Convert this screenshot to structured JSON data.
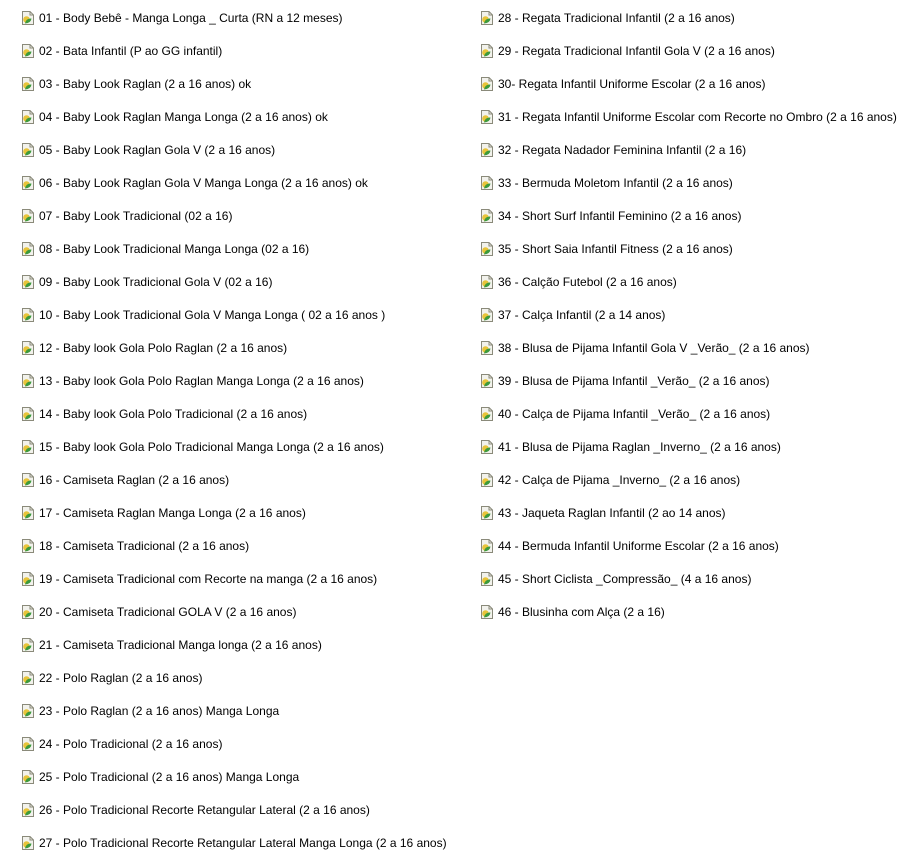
{
  "colors": {
    "icon_page": "#f2f2ec",
    "icon_border": "#8a8a7a",
    "icon_yellow": "#e8c43a",
    "icon_green": "#3c9a3c"
  },
  "icon": "document-image-icon",
  "files_left": [
    "01 - Body Bebê - Manga Longa _ Curta (RN a 12 meses)",
    "02 - Bata Infantil (P ao GG infantil)",
    "03 - Baby Look Raglan (2 a 16 anos) ok",
    "04 - Baby Look Raglan Manga Longa (2 a 16 anos) ok",
    "05 - Baby Look Raglan Gola V (2 a 16 anos)",
    "06 - Baby Look Raglan Gola V Manga Longa (2 a 16 anos) ok",
    "07 - Baby Look Tradicional (02 a 16)",
    "08 - Baby Look Tradicional Manga Longa (02 a 16)",
    "09 - Baby Look Tradicional Gola V (02 a 16)",
    "10 - Baby Look Tradicional Gola V Manga Longa ( 02 a 16 anos )",
    "12 - Baby look Gola Polo Raglan (2 a 16 anos)",
    "13 - Baby look Gola Polo Raglan Manga Longa (2 a 16 anos)",
    "14 - Baby look Gola Polo Tradicional (2 a 16 anos)",
    "15 - Baby look Gola Polo Tradicional Manga Longa (2 a 16 anos)",
    "16 - Camiseta Raglan (2 a 16 anos)",
    "17 - Camiseta Raglan Manga Longa (2 a 16 anos)",
    "18 - Camiseta Tradicional (2 a 16 anos)",
    "19 - Camiseta Tradicional com Recorte na manga (2 a 16 anos)",
    "20 - Camiseta Tradicional GOLA V (2 a 16 anos)",
    "21 - Camiseta Tradicional Manga longa (2 a 16 anos)",
    "22 - Polo Raglan (2 a 16 anos)",
    "23 - Polo Raglan (2 a 16 anos) Manga Longa",
    "24 - Polo Tradicional (2 a 16 anos)",
    "25 - Polo Tradicional (2 a 16 anos) Manga Longa",
    "26 - Polo Tradicional Recorte Retangular Lateral (2 a 16 anos)",
    "27 - Polo Tradicional Recorte Retangular Lateral Manga Longa (2 a 16 anos)"
  ],
  "files_right": [
    "28 - Regata Tradicional Infantil (2 a 16 anos)",
    "29 - Regata Tradicional Infantil Gola V (2 a 16 anos)",
    "30- Regata Infantil Uniforme Escolar (2 a 16 anos)",
    "31 - Regata Infantil Uniforme Escolar com Recorte no Ombro (2 a 16 anos)",
    "32 - Regata Nadador Feminina Infantil (2 a 16)",
    "33 - Bermuda Moletom Infantil (2 a 16 anos)",
    "34 - Short Surf Infantil Feminino  (2 a 16 anos)",
    "35 - Short Saia Infantil Fitness (2 a 16 anos)",
    "36 - Calção Futebol (2 a 16 anos)",
    "37 - Calça Infantil (2 a 14 anos)",
    "38 - Blusa de Pijama Infantil Gola V _Verão_ (2 a 16 anos)",
    "39 - Blusa de Pijama Infantil _Verão_ (2 a 16 anos)",
    "40 - Calça de Pijama Infantil _Verão_ (2 a 16 anos)",
    "41 - Blusa de Pijama Raglan _Inverno_ (2 a 16 anos)",
    "42 - Calça de Pijama _Inverno_ (2 a 16 anos)",
    "43 - Jaqueta Raglan Infantil (2 ao 14 anos)",
    "44 - Bermuda Infantil Uniforme Escolar (2 a 16 anos)",
    "45 - Short Ciclista _Compressão_ (4 a 16 anos)",
    "46 - Blusinha com Alça (2 a 16)"
  ]
}
